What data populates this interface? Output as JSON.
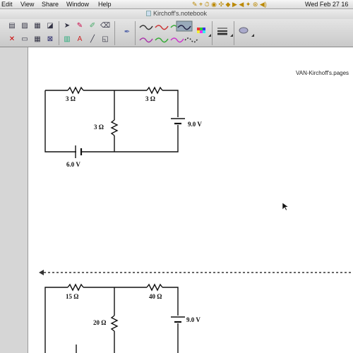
{
  "menubar": {
    "items": [
      "Edit",
      "View",
      "Share",
      "Window",
      "Help"
    ],
    "datetime": "Wed Feb 27  16"
  },
  "window": {
    "title": "Kirchoff's.notebook"
  },
  "page": {
    "filename": "VAN-Kirchoff's.pages"
  },
  "circuit1": {
    "r_left": "3 Ω",
    "r_right": "3 Ω",
    "r_middle": "3 Ω",
    "battery_right": "9.0 V",
    "battery_bottom": "6.0 V"
  },
  "circuit2": {
    "r_left": "15 Ω",
    "r_right": "40 Ω",
    "r_middle": "20 Ω",
    "battery_right": "9.0 V"
  },
  "colors": {
    "page_divider": "#333333",
    "sidebar": "#d6d6d6"
  }
}
